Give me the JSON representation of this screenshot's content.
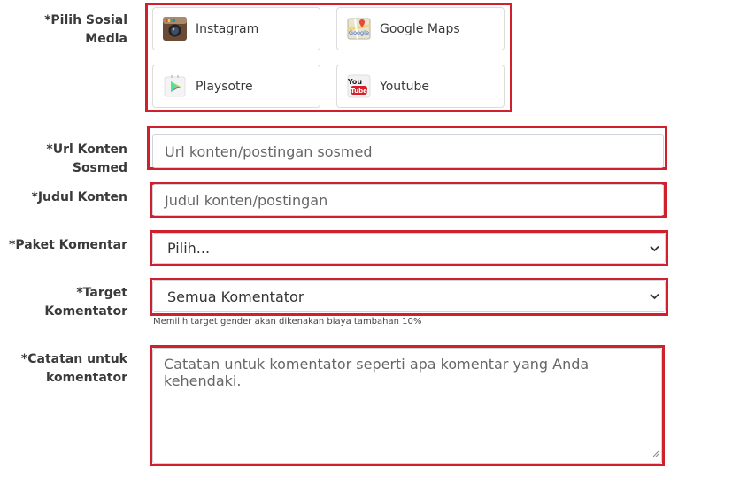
{
  "labels": {
    "social": "*Pilih Sosial Media",
    "url": "*Url Konten Sosmed",
    "judul": "*Judul Konten",
    "paket": "*Paket Komentar",
    "target": "*Target Komentator",
    "catatan_line1": "*Catatan untuk",
    "catatan_line2": "komentator"
  },
  "social_options": [
    {
      "label": "Instagram",
      "icon": "instagram-icon"
    },
    {
      "label": "Google Maps",
      "icon": "google-maps-icon"
    },
    {
      "label": "Playsotre",
      "icon": "play-store-icon"
    },
    {
      "label": "Youtube",
      "icon": "youtube-icon"
    }
  ],
  "inputs": {
    "url_placeholder": "Url konten/postingan sosmed",
    "judul_placeholder": "Judul konten/postingan",
    "paket_value": "Pilih...",
    "target_value": "Semua Komentator",
    "target_help": "Memilih target gender akan dikenakan biaya tambahan 10%",
    "catatan_placeholder": "Catatan untuk komentator seperti apa komentar yang Anda kehendaki."
  },
  "colors": {
    "highlight": "#d0202e",
    "border": "#cfd4da"
  }
}
